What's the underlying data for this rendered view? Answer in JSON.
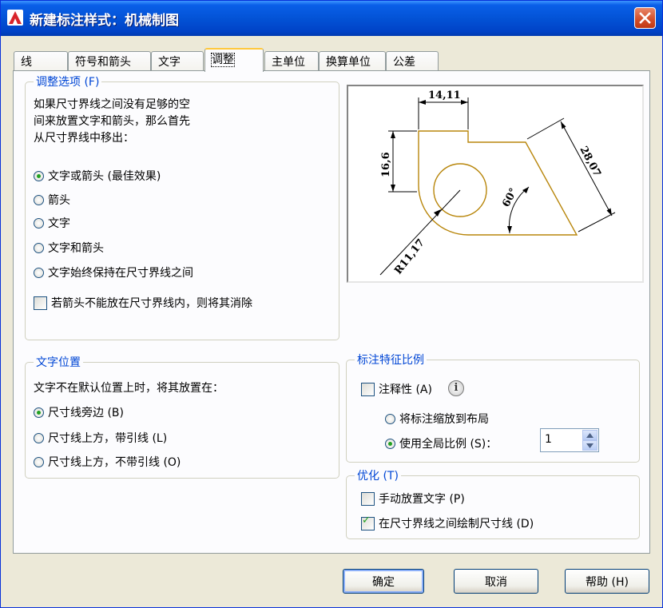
{
  "window": {
    "title": "新建标注样式：机械制图"
  },
  "tabs": [
    {
      "label": "线",
      "active": false
    },
    {
      "label": "符号和箭头",
      "active": false
    },
    {
      "label": "文字",
      "active": false
    },
    {
      "label": "调整",
      "active": true
    },
    {
      "label": "主单位",
      "active": false
    },
    {
      "label": "换算单位",
      "active": false
    },
    {
      "label": "公差",
      "active": false
    }
  ],
  "fit_options": {
    "legend": "调整选项 (F)",
    "description": [
      "如果尺寸界线之间没有足够的空",
      "间来放置文字和箭头，那么首先",
      "从尺寸界线中移出："
    ],
    "options": [
      {
        "label": "文字或箭头 (最佳效果)",
        "selected": true
      },
      {
        "label": "箭头",
        "selected": false
      },
      {
        "label": "文字",
        "selected": false
      },
      {
        "label": "文字和箭头",
        "selected": false
      },
      {
        "label": "文字始终保持在尺寸界线之间",
        "selected": false
      }
    ],
    "suppress_arrows": {
      "label": "若箭头不能放在尺寸界线内，则将其消除",
      "checked": false
    }
  },
  "preview": {
    "dim_top": "14,11",
    "dim_left": "16,6",
    "dim_right": "28,07",
    "dim_angle": "60°",
    "dim_radius": "R11,17"
  },
  "text_placement": {
    "legend": "文字位置",
    "description": "文字不在默认位置上时，将其放置在：",
    "options": [
      {
        "label": "尺寸线旁边 (B)",
        "selected": true
      },
      {
        "label": "尺寸线上方，带引线 (L)",
        "selected": false
      },
      {
        "label": "尺寸线上方，不带引线 (O)",
        "selected": false
      }
    ]
  },
  "scale": {
    "legend": "标注特征比例",
    "annotative": {
      "label": "注释性 (A)",
      "checked": false
    },
    "info_icon": "i",
    "options": [
      {
        "label": "将标注缩放到布局",
        "selected": false
      },
      {
        "label": "使用全局比例 (S)：",
        "selected": true
      }
    ],
    "global_scale_value": "1"
  },
  "fine_tuning": {
    "legend": "优化 (T)",
    "options": [
      {
        "label": "手动放置文字 (P)",
        "checked": false
      },
      {
        "label": "在尺寸界线之间绘制尺寸线 (D)",
        "checked": true
      }
    ]
  },
  "buttons": {
    "ok": "确定",
    "cancel": "取消",
    "help": "帮助 (H)"
  },
  "colors": {
    "title_bar": "#0353D6",
    "legend_text": "#0046D5",
    "preview_outline": "#B8860B",
    "check_mark": "#21A121"
  }
}
